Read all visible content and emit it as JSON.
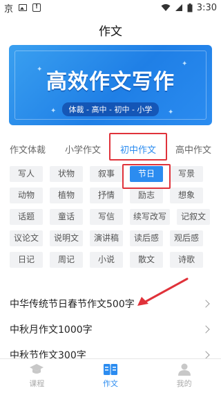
{
  "status": {
    "app": "京",
    "time": "3:30"
  },
  "title": "作文",
  "banner": {
    "title": "高效作文写作",
    "subtitle": "体裁 - 高中 - 初中 - 小学"
  },
  "tabs": [
    {
      "label": "作文体裁"
    },
    {
      "label": "小学作文"
    },
    {
      "label": "初中作文"
    },
    {
      "label": "高中作文"
    }
  ],
  "tags": [
    "写人",
    "状物",
    "叙事",
    "节日",
    "写景",
    "动物",
    "植物",
    "抒情",
    "励志",
    "想象",
    "话题",
    "童话",
    "写信",
    "续写改写",
    "记叙文",
    "议论文",
    "说明文",
    "演讲稿",
    "读后感",
    "观后感",
    "日记",
    "周记",
    "小说",
    "散文",
    "诗歌"
  ],
  "list": [
    "中华传统节日春节作文500字",
    "中秋月作文1000字",
    "中秋节作文300字"
  ],
  "nav": [
    {
      "label": "课程"
    },
    {
      "label": "作文"
    },
    {
      "label": "我的"
    }
  ],
  "colors": {
    "accent": "#2b8cf0",
    "highlight": "#e0323a"
  }
}
